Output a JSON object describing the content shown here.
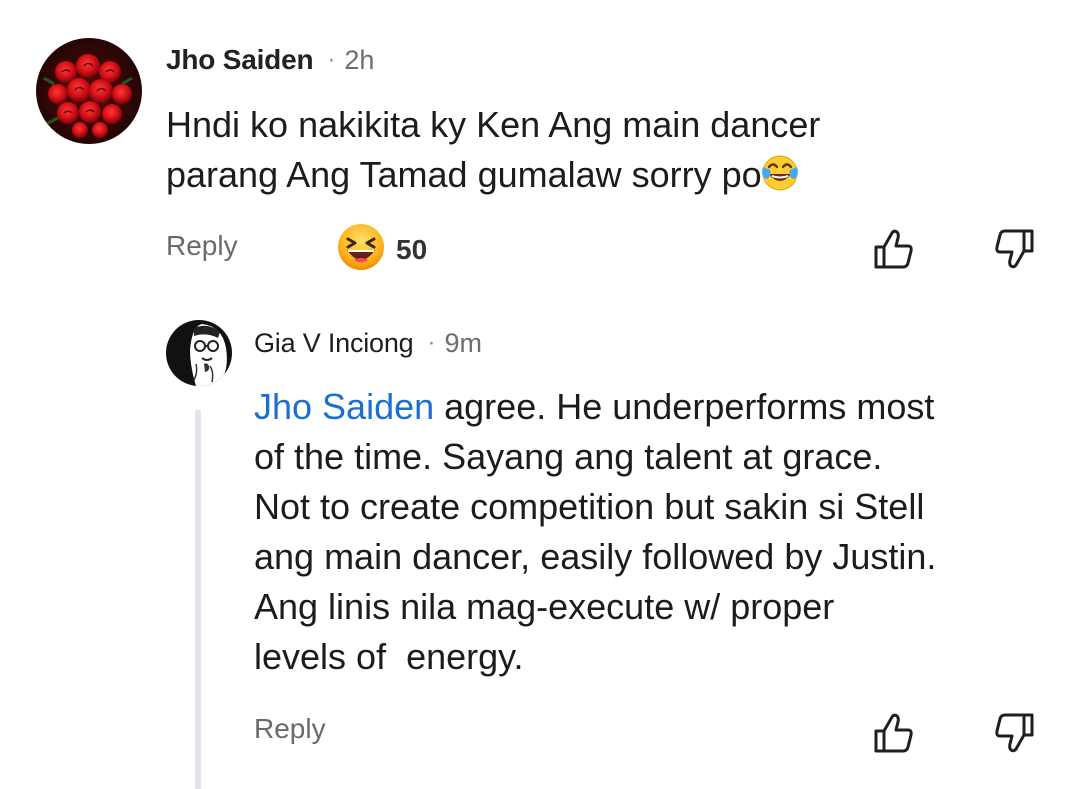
{
  "comment": {
    "author": "Jho Saiden",
    "separator": "·",
    "time": "2h",
    "text_line1": "Hndi ko nakikita ky Ken Ang main dancer",
    "text_line2": "parang Ang Tamad gumalaw sorry po",
    "reply_label": "Reply",
    "reaction_count": "50"
  },
  "reply": {
    "author": "Gia V Inciong",
    "separator": "·",
    "time": "9m",
    "mention": "Jho Saiden",
    "text_line1_rest": " agree. He underperforms most",
    "text_line2": "of the time. Sayang ang talent at grace.",
    "text_line3": "Not to create competition but sakin si Stell",
    "text_line4": "ang main dancer, easily followed by Justin.",
    "text_line5": "Ang linis nila mag-execute w/ proper",
    "text_line6": "levels of  energy.",
    "reply_label": "Reply"
  },
  "icons": {
    "main_avatar": "red-roses-avatar",
    "reply_avatar": "sketch-portrait-avatar",
    "tears_of_joy": "face-with-tears-of-joy-emoji",
    "laugh_reaction": "grinning-face-reaction",
    "like": "thumbs-up-icon",
    "dislike": "thumbs-down-icon"
  },
  "colors": {
    "mention": "#1c6fd1",
    "thread_line": "#e1e4e8",
    "meta_text": "#6e6e6e"
  }
}
